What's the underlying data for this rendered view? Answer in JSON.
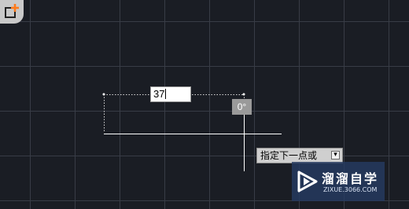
{
  "toolbar": {
    "add_icon": "add-view-icon"
  },
  "command": {
    "length_value": "37",
    "angle_value": "0°",
    "prompt_text": "指定下一点或",
    "prompt_more": "▾"
  },
  "watermark": {
    "title": "溜溜自学",
    "url": "ZIXUE.3066.COM"
  },
  "colors": {
    "background": "#1a1d24",
    "grid": "#3a3e48",
    "accent": "#ff7a1a",
    "watermark_bg": "#263a62"
  }
}
